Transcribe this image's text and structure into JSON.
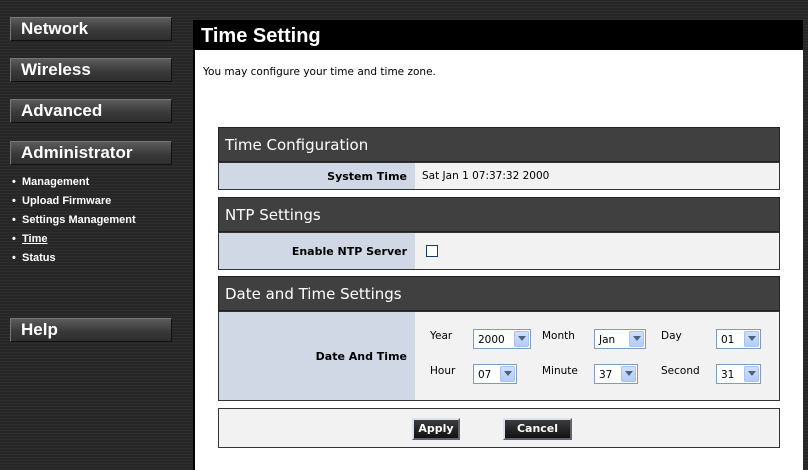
{
  "sidebar": {
    "nav": [
      {
        "label": "Network"
      },
      {
        "label": "Wireless"
      },
      {
        "label": "Advanced"
      },
      {
        "label": "Administrator"
      },
      {
        "label": "Help"
      }
    ],
    "bullet": "•",
    "sub_items": [
      {
        "label": "Management"
      },
      {
        "label": "Upload Firmware"
      },
      {
        "label": "Settings Management"
      },
      {
        "label": "Time",
        "active": true
      },
      {
        "label": "Status"
      }
    ]
  },
  "main": {
    "title": "Time Setting",
    "intro": "You may configure your time and time zone.",
    "time_config": {
      "heading": "Time Configuration",
      "system_time_label": "System Time",
      "system_time_value": "Sat Jan 1 07:37:32 2000"
    },
    "ntp": {
      "heading": "NTP Settings",
      "enable_label": "Enable NTP Server",
      "enabled": false
    },
    "date_time": {
      "heading": "Date and Time Settings",
      "row_label": "Date And Time",
      "year_label": "Year",
      "year": "2000",
      "month_label": "Month",
      "month": "Jan",
      "day_label": "Day",
      "day": "01",
      "hour_label": "Hour",
      "hour": "07",
      "minute_label": "Minute",
      "minute": "37",
      "second_label": "Second",
      "second": "31"
    },
    "buttons": {
      "apply": "Apply",
      "cancel": "Cancel"
    }
  },
  "colors": {
    "section_header": "#404040",
    "label_cell": "#d0d8e6",
    "row_bg": "#f2f2f2"
  }
}
